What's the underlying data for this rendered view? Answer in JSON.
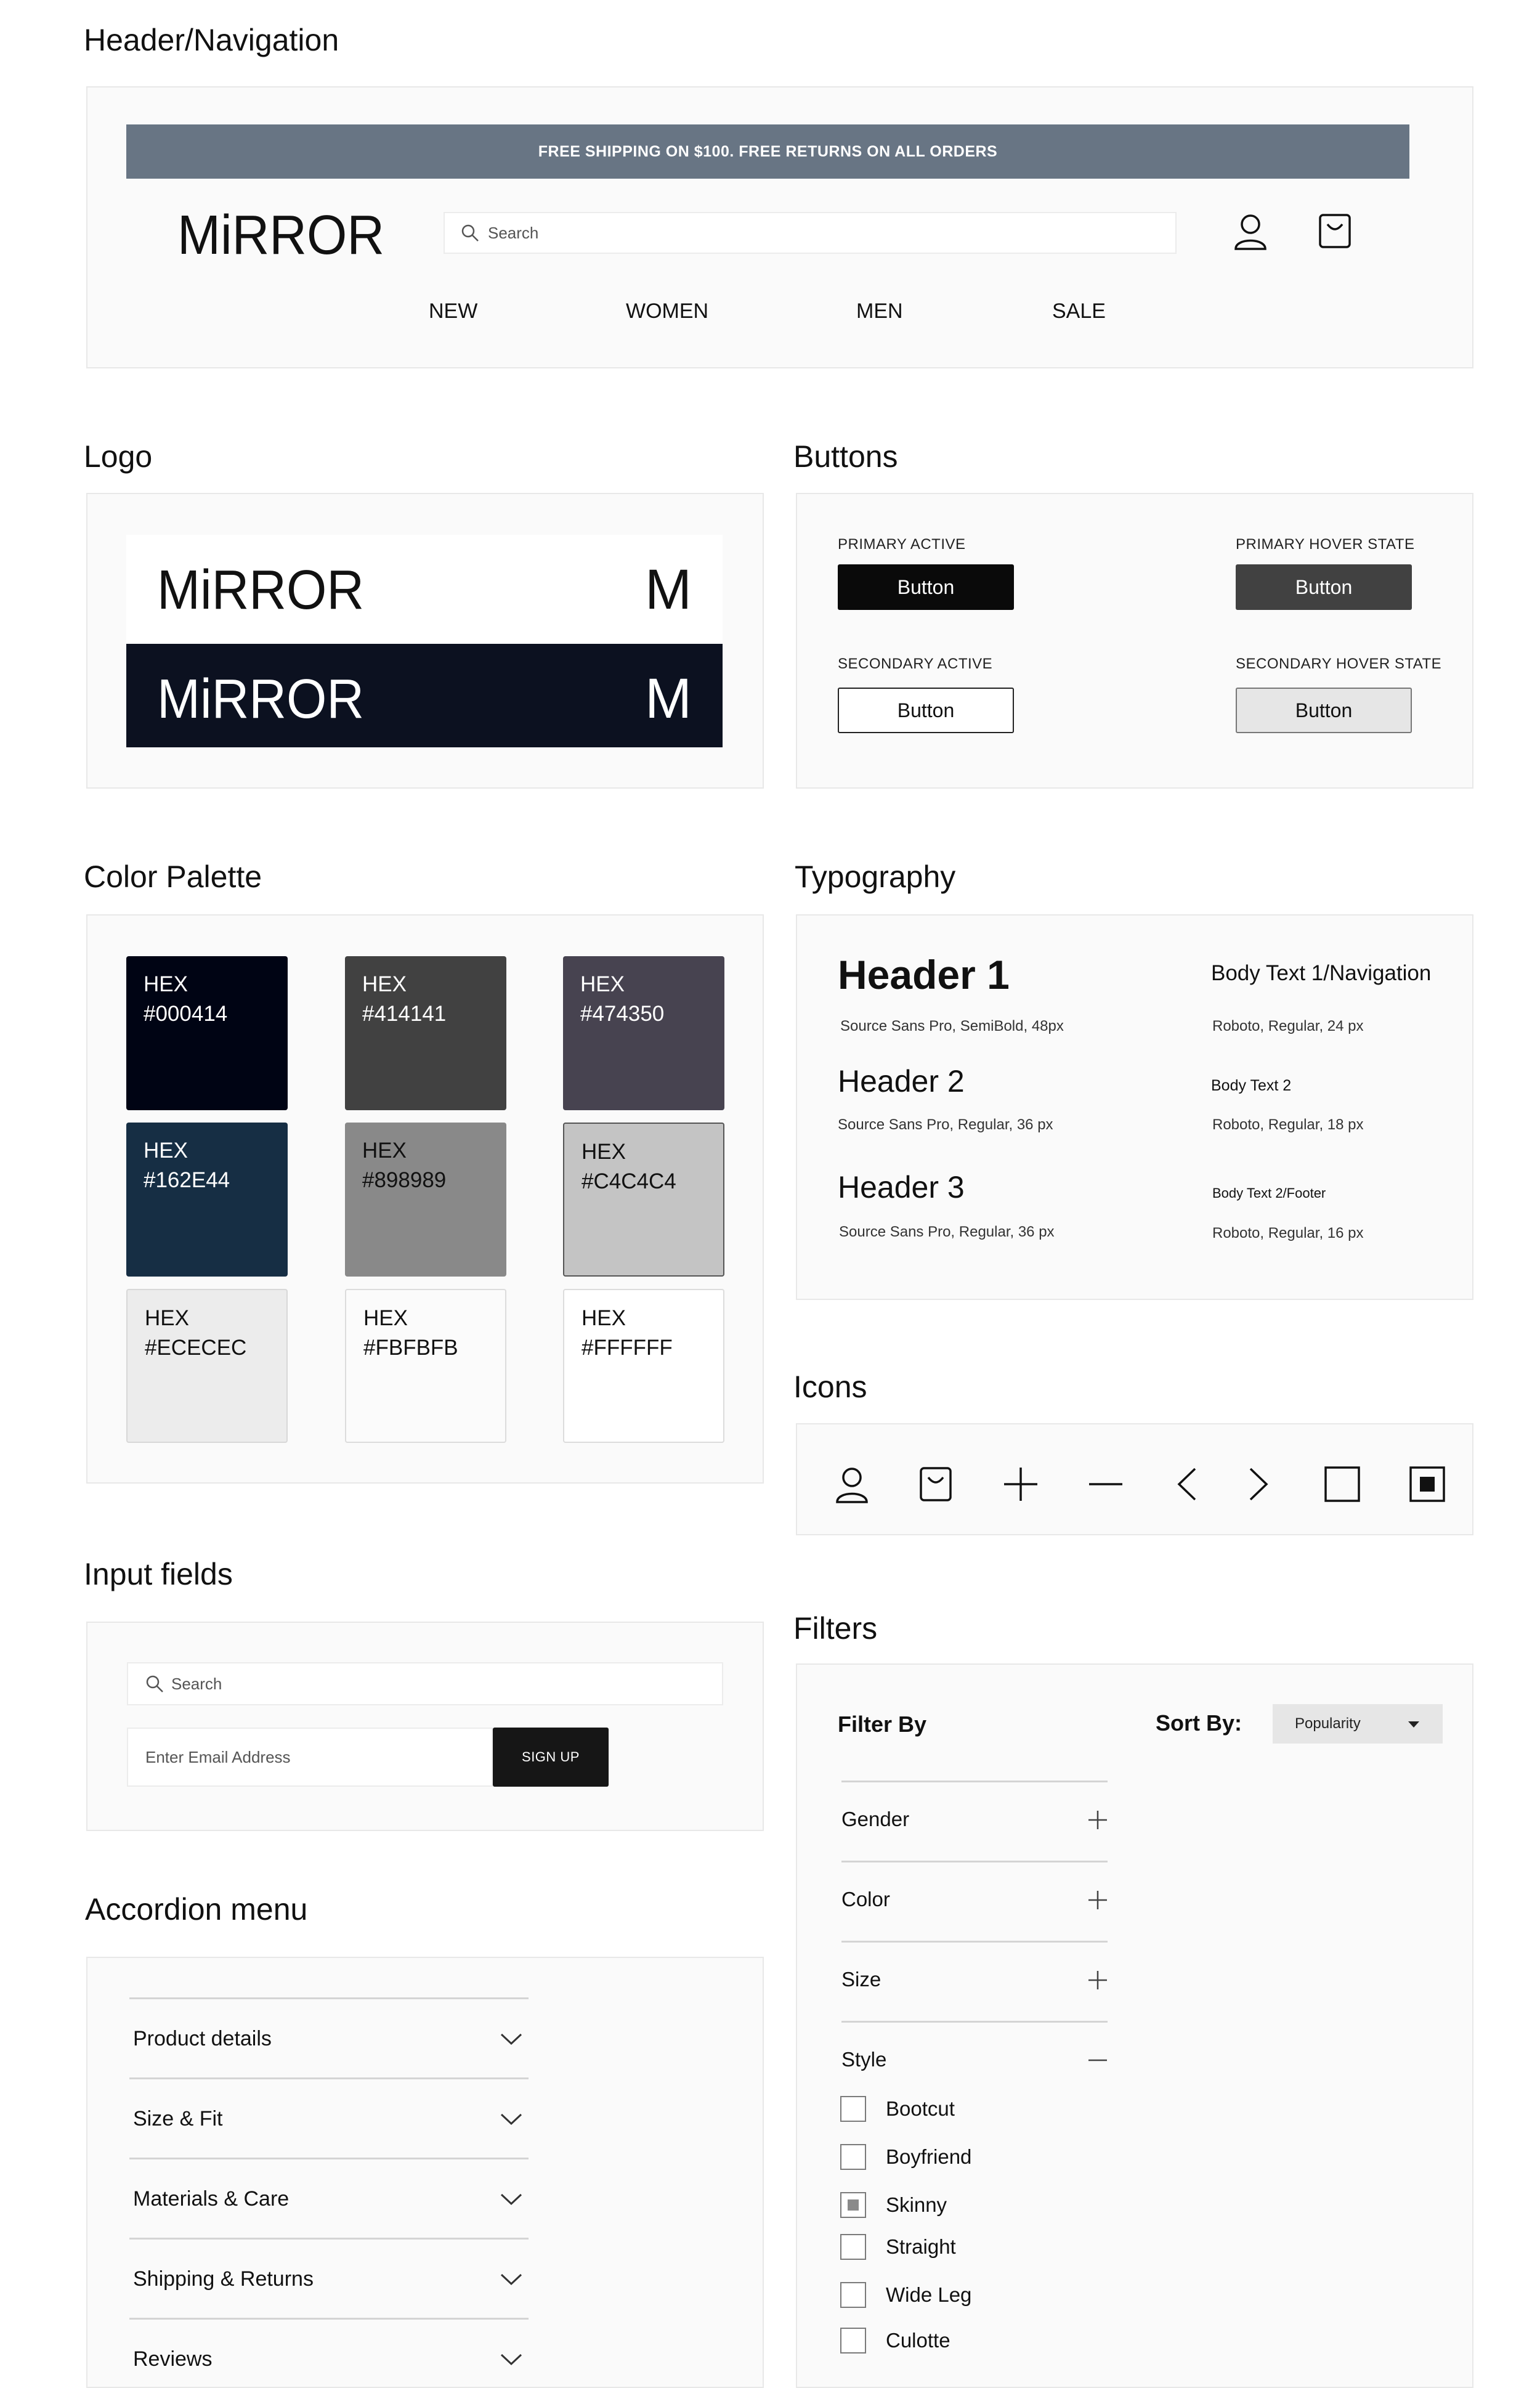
{
  "sections": {
    "header": "Header/Navigation",
    "logo": "Logo",
    "buttons": "Buttons",
    "palette": "Color Palette",
    "typography": "Typography",
    "icons": "Icons",
    "inputs": "Input fields",
    "filters": "Filters",
    "accordion": "Accordion menu"
  },
  "header": {
    "banner": "FREE SHIPPING  ON $100. FREE RETURNS ON ALL ORDERS",
    "logo_text": "MiRROR",
    "search_placeholder": "Search",
    "nav": [
      "NEW",
      "WOMEN",
      "MEN",
      "SALE"
    ],
    "icons": [
      "user-icon",
      "shopping-bag-icon"
    ]
  },
  "logo": {
    "wordmark": "MiRROR",
    "monogram": "M",
    "colors": {
      "light_bg": "#FFFFFF",
      "dark_bg": "#0C1120"
    }
  },
  "buttons": {
    "primary_active": {
      "label": "PRIMARY ACTIVE",
      "text": "Button"
    },
    "primary_hover": {
      "label": "PRIMARY HOVER STATE",
      "text": "Button"
    },
    "secondary_active": {
      "label": "SECONDARY ACTIVE",
      "text": "Button"
    },
    "secondary_hover": {
      "label": "SECONDARY HOVER STATE",
      "text": "Button"
    }
  },
  "palette": [
    {
      "prefix": "HEX",
      "hex": "#000414",
      "text_color": "#FFFFFF"
    },
    {
      "prefix": "HEX",
      "hex": "#414141",
      "text_color": "#FFFFFF"
    },
    {
      "prefix": "HEX",
      "hex": "#474350",
      "text_color": "#FFFFFF"
    },
    {
      "prefix": "HEX",
      "hex": "#162E44",
      "text_color": "#FFFFFF"
    },
    {
      "prefix": "HEX",
      "hex": "#898989",
      "text_color": "#111111"
    },
    {
      "prefix": "HEX",
      "hex": "#C4C4C4",
      "text_color": "#111111"
    },
    {
      "prefix": "HEX",
      "hex": "#ECECEC",
      "text_color": "#111111"
    },
    {
      "prefix": "HEX",
      "hex": "#FBFBFB",
      "text_color": "#111111"
    },
    {
      "prefix": "HEX",
      "hex": "#FFFFFF",
      "text_color": "#111111"
    }
  ],
  "typography": {
    "h1": {
      "sample": "Header 1",
      "spec": "Source Sans Pro, SemiBold, 48px"
    },
    "h2": {
      "sample": "Header 2",
      "spec": "Source Sans Pro, Regular, 36 px"
    },
    "h3": {
      "sample": "Header 3",
      "spec": "Source Sans Pro, Regular, 36 px"
    },
    "b1": {
      "sample": "Body Text 1/Navigation",
      "spec": "Roboto, Regular, 24 px"
    },
    "b2": {
      "sample": "Body Text 2",
      "spec": "Roboto, Regular, 18 px"
    },
    "b3": {
      "sample": "Body Text 2/Footer",
      "spec": "Roboto, Regular, 16 px"
    }
  },
  "icons": [
    "user-icon",
    "shopping-bag-icon",
    "plus-icon",
    "minus-icon",
    "chevron-left-icon",
    "chevron-right-icon",
    "checkbox-empty-icon",
    "checkbox-checked-icon"
  ],
  "inputs": {
    "search_placeholder": "Search",
    "email_placeholder": "Enter Email Address",
    "signup_label": "SIGN UP"
  },
  "accordion": [
    "Product details",
    "Size & Fit",
    "Materials & Care",
    "Shipping & Returns",
    "Reviews"
  ],
  "filters": {
    "title": "Filter By",
    "sort_label": "Sort By:",
    "sort_value": "Popularity",
    "groups": [
      {
        "label": "Gender",
        "state": "collapsed"
      },
      {
        "label": "Color",
        "state": "collapsed"
      },
      {
        "label": "Size",
        "state": "collapsed"
      },
      {
        "label": "Style",
        "state": "expanded"
      }
    ],
    "style_options": [
      {
        "label": "Bootcut",
        "checked": false
      },
      {
        "label": "Boyfriend",
        "checked": false
      },
      {
        "label": "Skinny",
        "checked": true
      },
      {
        "label": "Straight",
        "checked": false
      },
      {
        "label": "Wide Leg",
        "checked": false
      },
      {
        "label": "Culotte",
        "checked": false
      }
    ]
  }
}
